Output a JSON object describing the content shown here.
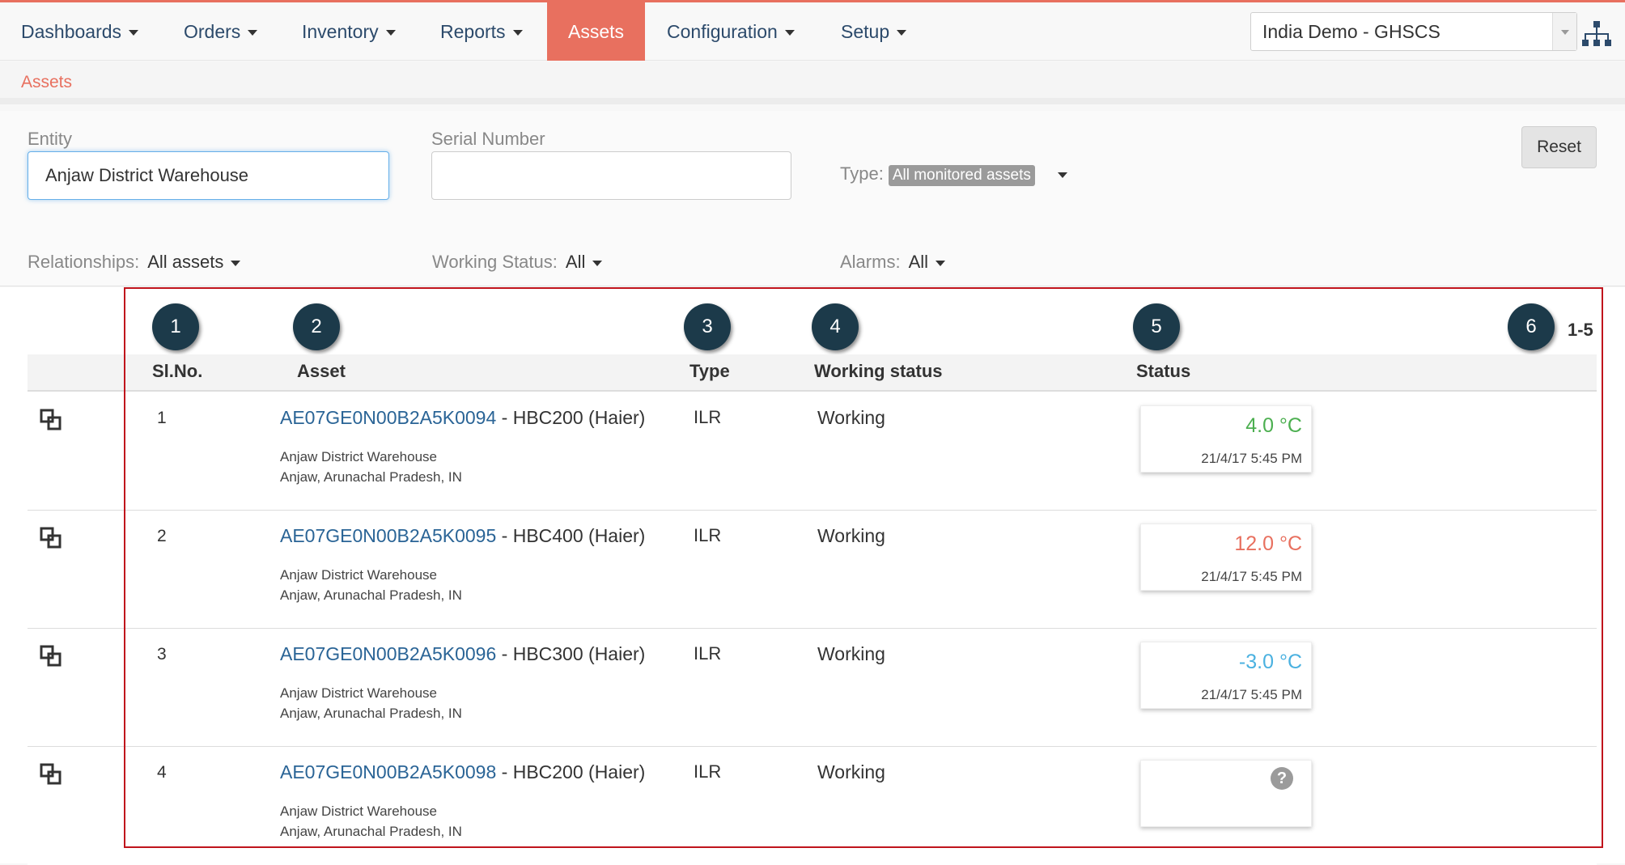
{
  "nav": {
    "items": [
      {
        "label": "Dashboards"
      },
      {
        "label": "Orders"
      },
      {
        "label": "Inventory"
      },
      {
        "label": "Reports"
      },
      {
        "label": "Assets"
      },
      {
        "label": "Configuration"
      },
      {
        "label": "Setup"
      }
    ],
    "active": "Assets",
    "domain": "India Demo - GHSCS"
  },
  "breadcrumb": {
    "current": "Assets"
  },
  "filters": {
    "entity_label": "Entity",
    "entity_value": "Anjaw District Warehouse",
    "serial_label": "Serial Number",
    "serial_value": "",
    "type_label": "Type:",
    "type_value": "All monitored assets",
    "reset_label": "Reset",
    "relationships_label": "Relationships:",
    "relationships_value": "All assets",
    "working_status_label": "Working Status:",
    "working_status_value": "All",
    "alarms_label": "Alarms:",
    "alarms_value": "All"
  },
  "annotations": [
    "1",
    "2",
    "3",
    "4",
    "5",
    "6"
  ],
  "table": {
    "columns": {
      "sl": "Sl.No.",
      "asset": "Asset",
      "type": "Type",
      "working_status": "Working status",
      "status": "Status"
    },
    "range": "1-5",
    "rows": [
      {
        "sl": "1",
        "asset_id": "AE07GE0N00B2A5K0094",
        "model": " - HBC200 (Haier)",
        "entity": "Anjaw District Warehouse",
        "location": "Anjaw, Arunachal Pradesh, IN",
        "type": "ILR",
        "working_status": "Working",
        "temp": "4.0 °C",
        "temp_color": "#4caf50",
        "time": "21/4/17 5:45 PM"
      },
      {
        "sl": "2",
        "asset_id": "AE07GE0N00B2A5K0095",
        "model": " - HBC400 (Haier)",
        "entity": "Anjaw District Warehouse",
        "location": "Anjaw, Arunachal Pradesh, IN",
        "type": "ILR",
        "working_status": "Working",
        "temp": "12.0 °C",
        "temp_color": "#e8705f",
        "time": "21/4/17 5:45 PM"
      },
      {
        "sl": "3",
        "asset_id": "AE07GE0N00B2A5K0096",
        "model": " - HBC300 (Haier)",
        "entity": "Anjaw District Warehouse",
        "location": "Anjaw, Arunachal Pradesh, IN",
        "type": "ILR",
        "working_status": "Working",
        "temp": "-3.0 °C",
        "temp_color": "#4ab1e0",
        "time": "21/4/17 5:45 PM"
      },
      {
        "sl": "4",
        "asset_id": "AE07GE0N00B2A5K0098",
        "model": " - HBC200 (Haier)",
        "entity": "Anjaw District Warehouse",
        "location": "Anjaw, Arunachal Pradesh, IN",
        "type": "ILR",
        "working_status": "Working",
        "unknown_icon": "?"
      }
    ]
  }
}
